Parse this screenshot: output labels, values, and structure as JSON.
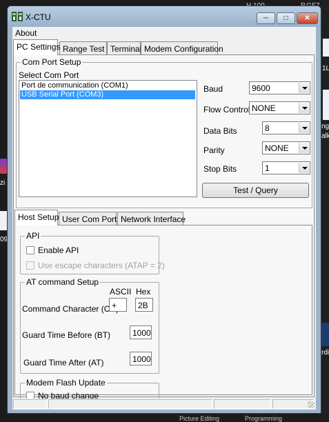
{
  "window": {
    "title": "X-CTU",
    "minimize_glyph": "─",
    "maximize_glyph": "□",
    "close_glyph": "✕"
  },
  "menu": {
    "about": "About"
  },
  "tabs": [
    "PC Settings",
    "Range Test",
    "Terminal",
    "Modem Configuration"
  ],
  "com_port_setup": {
    "group_label": "Com Port Setup",
    "select_label": "Select Com Port",
    "ports": [
      "Port de communication (COM1)",
      "USB Serial Port (COM3)"
    ],
    "baud_label": "Baud",
    "baud_value": "9600",
    "flow_label": "Flow Control",
    "flow_value": "NONE",
    "databits_label": "Data Bits",
    "databits_value": "8",
    "parity_label": "Parity",
    "parity_value": "NONE",
    "stopbits_label": "Stop Bits",
    "stopbits_value": "1",
    "test_button": "Test / Query"
  },
  "sub_tabs": [
    "Host Setup",
    "User Com Ports",
    "Network Interface"
  ],
  "api": {
    "group_label": "API",
    "enable_api": "Enable API",
    "escape_chars": "Use escape characters (ATAP = 2)"
  },
  "at_command": {
    "group_label": "AT command Setup",
    "ascii_header": "ASCII",
    "hex_header": "Hex",
    "cc_label": "Command Character (CC)",
    "cc_ascii": "+",
    "cc_hex": "2B",
    "bt_label": "Guard Time Before (BT)",
    "bt_value": "1000",
    "at_label": "Guard Time After (AT)",
    "at_value": "1000"
  },
  "flash_update": {
    "group_label": "Modem Flash Update",
    "no_baud_change": "No baud change"
  },
  "desktop": {
    "right_texts": [
      "1L",
      "ng",
      "alk",
      "rdi"
    ],
    "left_texts": [
      "zi",
      "09"
    ],
    "bottom_texts": [
      "Picture Editing",
      "Programming"
    ],
    "top_texts": [
      "H 100",
      "P.GF7"
    ]
  },
  "colors": {
    "selection": "#3399ff",
    "title_bar": "#a9c0d6",
    "close_button": "#c4432a"
  }
}
